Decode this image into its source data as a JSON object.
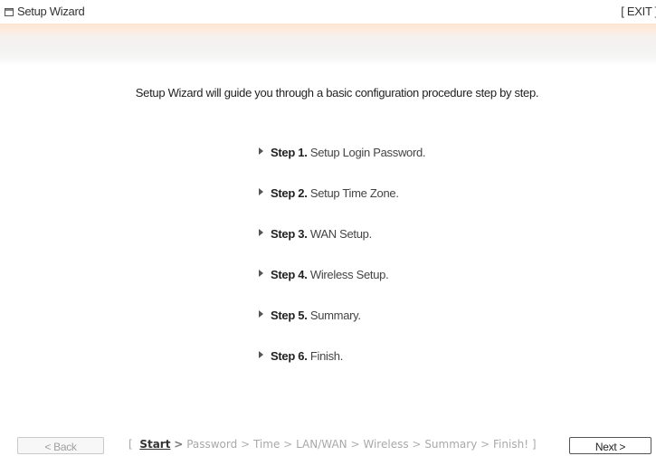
{
  "window": {
    "title": "Setup Wizard",
    "exit_label": "[ EXIT ]"
  },
  "intro": "Setup Wizard will guide you through a basic configuration procedure step by step.",
  "steps": [
    {
      "number": "Step 1.",
      "desc": "Setup Login Password."
    },
    {
      "number": "Step 2.",
      "desc": "Setup Time Zone."
    },
    {
      "number": "Step 3.",
      "desc": "WAN Setup."
    },
    {
      "number": "Step 4.",
      "desc": "Wireless Setup."
    },
    {
      "number": "Step 5.",
      "desc": "Summary."
    },
    {
      "number": "Step 6.",
      "desc": "Finish."
    }
  ],
  "footer": {
    "back_label": "< Back",
    "next_label": "Next >",
    "breadcrumb": {
      "open": "[",
      "items": [
        "Start",
        "Password",
        "Time",
        "LAN/WAN",
        "Wireless",
        "Summary",
        "Finish!"
      ],
      "separator": ">",
      "close": "]"
    }
  }
}
